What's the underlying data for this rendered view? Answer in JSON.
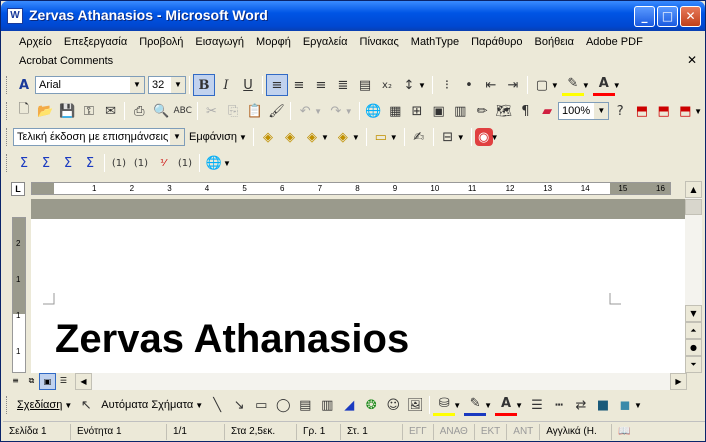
{
  "window": {
    "title": "Zervas Athanasios - Microsoft Word",
    "app_icon": "W",
    "min": "_",
    "max": "□",
    "close": "✕"
  },
  "menu": {
    "row1": [
      "Αρχείο",
      "Επεξεργασία",
      "Προβολή",
      "Εισαγωγή",
      "Μορφή",
      "Εργαλεία",
      "Πίνακας",
      "MathType",
      "Παράθυρο",
      "Βοήθεια",
      "Adobe PDF"
    ],
    "row2": [
      "Acrobat Comments"
    ]
  },
  "formatting": {
    "font": "Arial",
    "size": "32",
    "bold": "B",
    "italic": "I",
    "underline": "U"
  },
  "standard": {
    "zoom": "100%"
  },
  "review": {
    "display_mode": "Τελική έκδοση με επισημάνσεις",
    "show_label": "Εμφάνιση"
  },
  "ruler": {
    "h_numbers": [
      "1",
      "2",
      "3",
      "4",
      "5",
      "6",
      "7",
      "8",
      "9",
      "10",
      "11",
      "12",
      "13",
      "14",
      "15",
      "16"
    ],
    "v_numbers": [
      "2",
      "1",
      "1",
      "1"
    ]
  },
  "document": {
    "heading": "Zervas Athanasios"
  },
  "drawing": {
    "draw_label": "Σχεδίαση",
    "autoshapes_label": "Αυτόματα Σχήματα"
  },
  "status": {
    "page": "Σελίδα 1",
    "section": "Ενότητα 1",
    "page_of": "1/1",
    "at": "Στα 2,5εκ.",
    "line": "Γρ. 1",
    "col": "Στ. 1",
    "rec": "ΕΓΓ",
    "trk": "ΑΝΑΘ",
    "ext": "ΕΚΤ",
    "ovr": "ΑΝΤ",
    "lang": "Αγγλικά (Η."
  },
  "colors": {
    "title_bar": "#0055e5",
    "chrome": "#ece9d8",
    "highlight": "#ffff00",
    "font_color": "#ff0000"
  }
}
